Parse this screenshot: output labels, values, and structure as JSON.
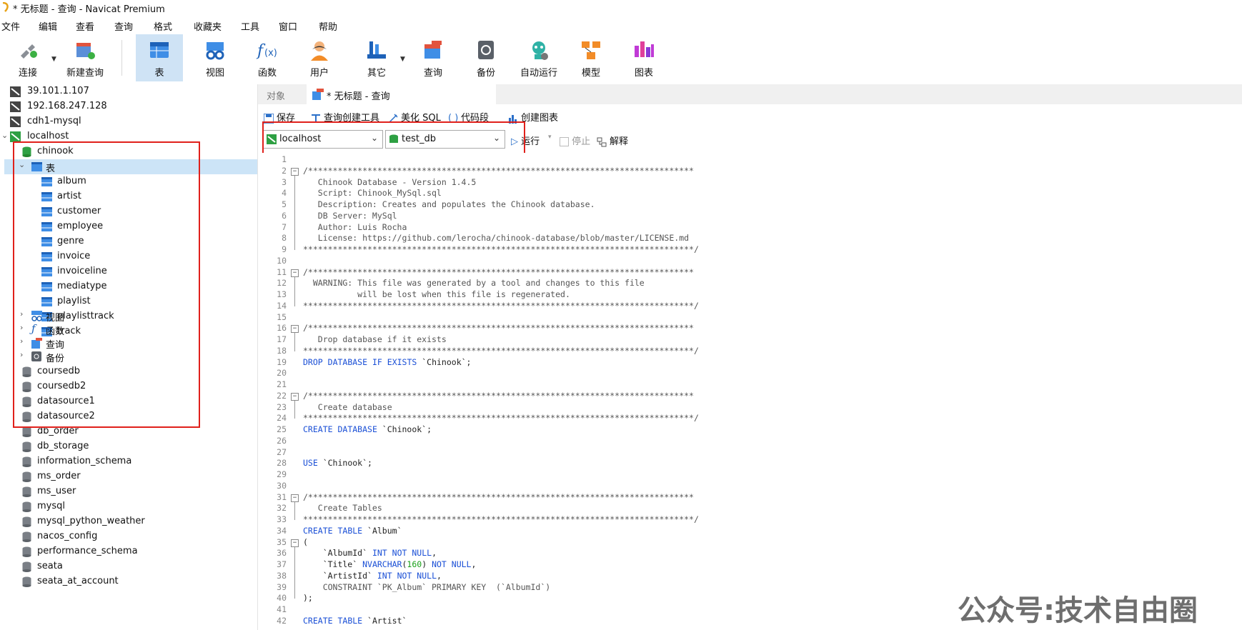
{
  "window": {
    "title": "* 无标题 - 查询 - Navicat Premium"
  },
  "menu": [
    "文件",
    "编辑",
    "查看",
    "查询",
    "格式",
    "收藏夹",
    "工具",
    "窗口",
    "帮助"
  ],
  "toolbar": [
    {
      "label": "连接",
      "icon": "connect-icon"
    },
    {
      "label": "新建查询",
      "icon": "new-query-icon"
    },
    {
      "label": "表",
      "icon": "table-icon",
      "active": true
    },
    {
      "label": "视图",
      "icon": "view-icon"
    },
    {
      "label": "函数",
      "icon": "function-icon"
    },
    {
      "label": "用户",
      "icon": "user-icon"
    },
    {
      "label": "其它",
      "icon": "other-icon"
    },
    {
      "label": "查询",
      "icon": "query-icon"
    },
    {
      "label": "备份",
      "icon": "backup-icon"
    },
    {
      "label": "自动运行",
      "icon": "auto-run-icon"
    },
    {
      "label": "模型",
      "icon": "model-icon"
    },
    {
      "label": "图表",
      "icon": "chart-icon"
    }
  ],
  "sidebar": {
    "connections": [
      "39.101.1.107",
      "192.168.247.128",
      "cdh1-mysql",
      "localhost"
    ],
    "active_db": "chinook",
    "tables_group": "表",
    "tables": [
      "album",
      "artist",
      "customer",
      "employee",
      "genre",
      "invoice",
      "invoiceline",
      "mediatype",
      "playlist",
      "playlisttrack",
      "track"
    ],
    "groups": [
      "视图",
      "函数",
      "查询",
      "备份"
    ],
    "databases": [
      "coursedb",
      "coursedb2",
      "datasource1",
      "datasource2",
      "db_order",
      "db_storage",
      "information_schema",
      "ms_order",
      "ms_user",
      "mysql",
      "mysql_python_weather",
      "nacos_config",
      "performance_schema",
      "seata",
      "seata_at_account"
    ]
  },
  "tabs": {
    "objects": "对象",
    "query": "* 无标题 - 查询"
  },
  "query_toolbar": [
    "保存",
    "查询创建工具",
    "美化 SQL",
    "代码段",
    "创建图表"
  ],
  "conn_bar": {
    "connection": "localhost",
    "database": "test_db",
    "run": "运行",
    "stop": "停止",
    "explain": "解释"
  },
  "code_lines": [
    "",
    "/******************************************************************************",
    "   Chinook Database - Version 1.4.5",
    "   Script: Chinook_MySql.sql",
    "   Description: Creates and populates the Chinook database.",
    "   DB Server: MySql",
    "   Author: Luis Rocha",
    "   License: https://github.com/lerocha/chinook-database/blob/master/LICENSE.md",
    "*******************************************************************************/",
    "",
    "/******************************************************************************",
    "  WARNING: This file was generated by a tool and changes to this file",
    "           will be lost when this file is regenerated.",
    "*******************************************************************************/",
    "",
    "/******************************************************************************",
    "   Drop database if it exists",
    "*******************************************************************************/",
    "DROP DATABASE IF EXISTS `Chinook`;",
    "",
    "",
    "/******************************************************************************",
    "   Create database",
    "*******************************************************************************/",
    "CREATE DATABASE `Chinook`;",
    "",
    "",
    "USE `Chinook`;",
    "",
    "",
    "/******************************************************************************",
    "   Create Tables",
    "*******************************************************************************/",
    "CREATE TABLE `Album`",
    "(",
    "    `AlbumId` INT NOT NULL,",
    "    `Title` NVARCHAR(160) NOT NULL,",
    "    `ArtistId` INT NOT NULL,",
    "    CONSTRAINT `PK_Album` PRIMARY KEY  (`AlbumId`)",
    ");",
    "",
    "CREATE TABLE `Artist`"
  ],
  "watermark": "公众号:技术自由圈",
  "colors": {
    "accent": "#cfe3f5",
    "highlight_box": "#e0201b",
    "keyword": "#1a4fd6",
    "number": "#19a019"
  }
}
